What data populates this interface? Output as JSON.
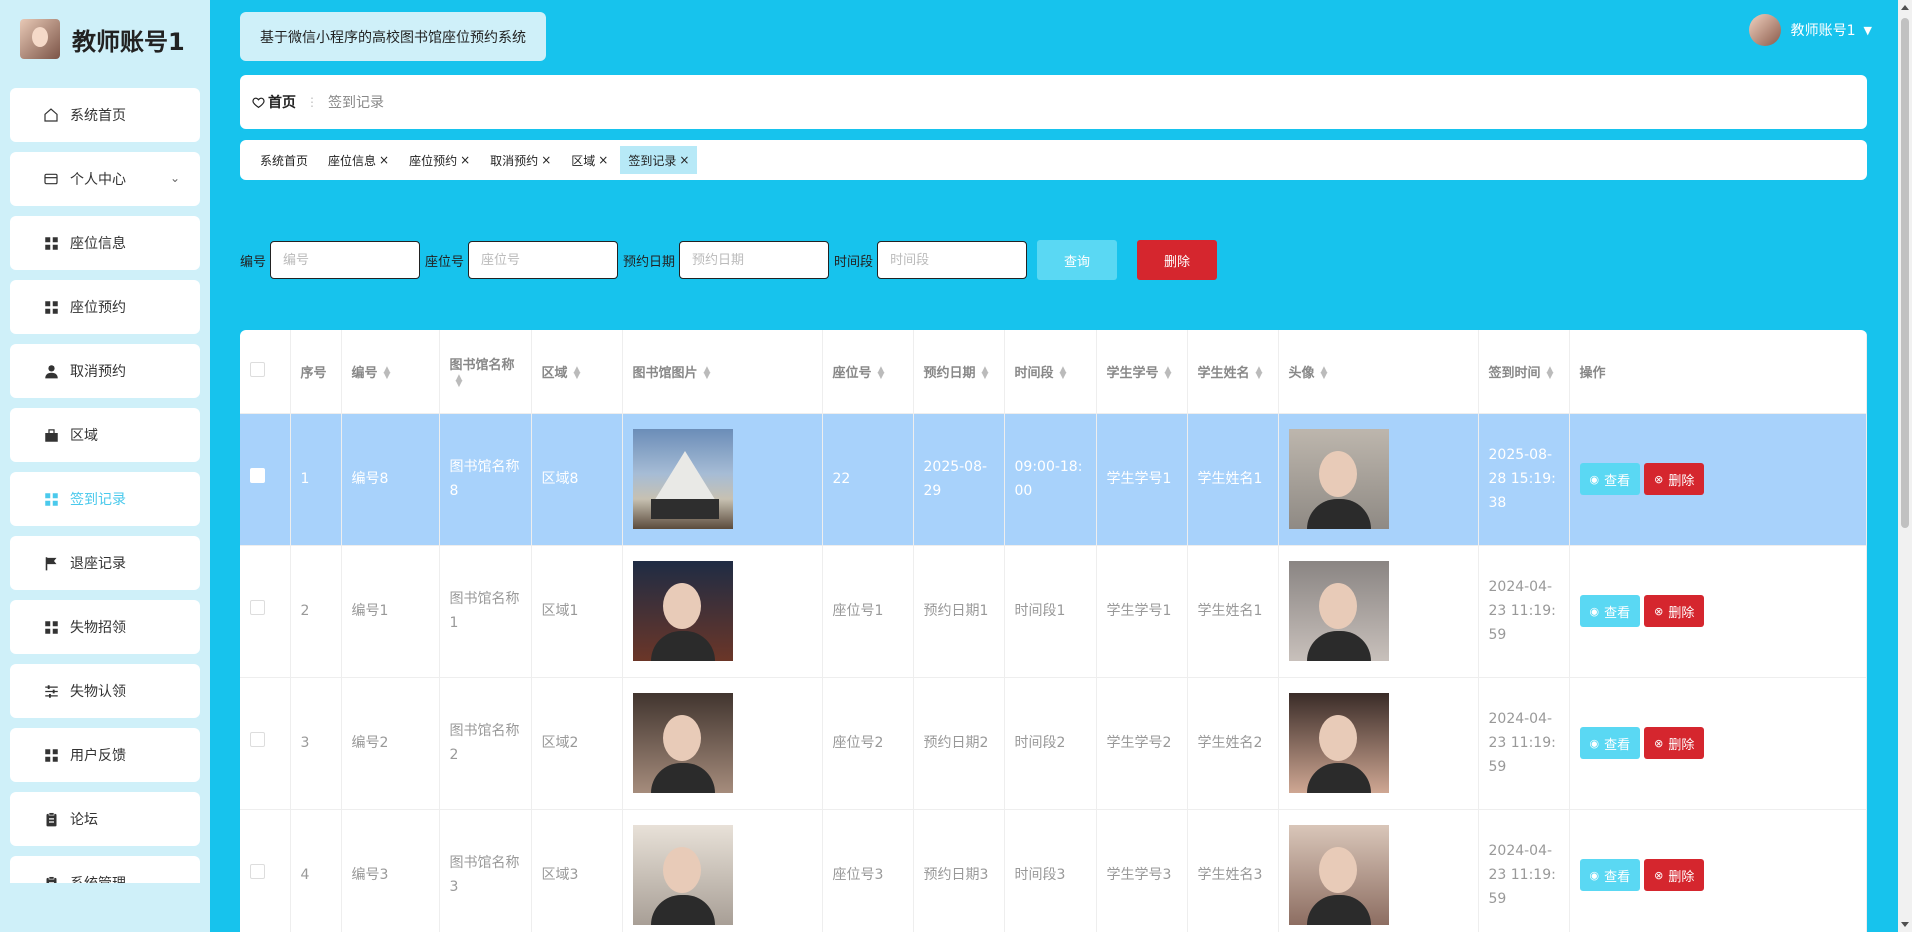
{
  "brand": {
    "title": "教师账号1"
  },
  "sidebar": {
    "items": [
      {
        "label": "系统首页",
        "icon": "home-icon"
      },
      {
        "label": "个人中心",
        "icon": "card-icon",
        "expand": "⌄"
      },
      {
        "label": "座位信息",
        "icon": "grid-icon"
      },
      {
        "label": "座位预约",
        "icon": "grid-icon"
      },
      {
        "label": "取消预约",
        "icon": "user-icon"
      },
      {
        "label": "区域",
        "icon": "briefcase-icon"
      },
      {
        "label": "签到记录",
        "icon": "grid-icon",
        "active": true
      },
      {
        "label": "退座记录",
        "icon": "flag-icon"
      },
      {
        "label": "失物招领",
        "icon": "grid-icon"
      },
      {
        "label": "失物认领",
        "icon": "sliders-icon"
      },
      {
        "label": "用户反馈",
        "icon": "grid-icon"
      },
      {
        "label": "论坛",
        "icon": "clipboard-icon"
      },
      {
        "label": "系统管理",
        "icon": "clipboard-icon",
        "expand": "⌄"
      }
    ]
  },
  "header": {
    "system_title": "基于微信小程序的高校图书馆座位预约系统",
    "user_name": "教师账号1"
  },
  "breadcrumb": {
    "home": "首页",
    "current": "签到记录"
  },
  "tabs": [
    {
      "label": "系统首页",
      "closable": false
    },
    {
      "label": "座位信息",
      "closable": true
    },
    {
      "label": "座位预约",
      "closable": true
    },
    {
      "label": "取消预约",
      "closable": true
    },
    {
      "label": "区域",
      "closable": true
    },
    {
      "label": "签到记录",
      "closable": true,
      "active": true
    }
  ],
  "search": {
    "fields": [
      {
        "label": "编号",
        "placeholder": "编号"
      },
      {
        "label": "座位号",
        "placeholder": "座位号"
      },
      {
        "label": "预约日期",
        "placeholder": "预约日期"
      },
      {
        "label": "时间段",
        "placeholder": "时间段"
      }
    ],
    "query_label": "查询",
    "delete_label": "删除"
  },
  "table": {
    "columns": [
      "",
      "序号",
      "编号",
      "图书馆名称",
      "区域",
      "图书馆图片",
      "座位号",
      "预约日期",
      "时间段",
      "学生学号",
      "学生姓名",
      "头像",
      "签到时间",
      "操作"
    ],
    "sortable": [
      false,
      false,
      true,
      true,
      true,
      true,
      true,
      true,
      true,
      true,
      true,
      true,
      true,
      false
    ],
    "view_label": "查看",
    "delete_label": "删除",
    "rows": [
      {
        "no": "1",
        "code": "编号8",
        "lib": "图书馆名称8",
        "area": "区域8",
        "seat": "22",
        "date": "2025-08-29",
        "period": "09:00-18:00",
        "sid": "学生学号1",
        "sname": "学生姓名1",
        "time": "2025-08-28 15:19:38",
        "selected": true,
        "lib_img": "lib",
        "avatar_img": "f2"
      },
      {
        "no": "2",
        "code": "编号1",
        "lib": "图书馆名称1",
        "area": "区域1",
        "seat": "座位号1",
        "date": "预约日期1",
        "period": "时间段1",
        "sid": "学生学号1",
        "sname": "学生姓名1",
        "time": "2024-04-23 11:19:59",
        "selected": false,
        "lib_img": "f3",
        "avatar_img": "f4"
      },
      {
        "no": "3",
        "code": "编号2",
        "lib": "图书馆名称2",
        "area": "区域2",
        "seat": "座位号2",
        "date": "预约日期2",
        "period": "时间段2",
        "sid": "学生学号2",
        "sname": "学生姓名2",
        "time": "2024-04-23 11:19:59",
        "selected": false,
        "lib_img": "f6",
        "avatar_img": "f7"
      },
      {
        "no": "4",
        "code": "编号3",
        "lib": "图书馆名称3",
        "area": "区域3",
        "seat": "座位号3",
        "date": "预约日期3",
        "period": "时间段3",
        "sid": "学生学号3",
        "sname": "学生姓名3",
        "time": "2024-04-23 11:19:59",
        "selected": false,
        "lib_img": "f5",
        "avatar_img": "f8"
      }
    ]
  }
}
